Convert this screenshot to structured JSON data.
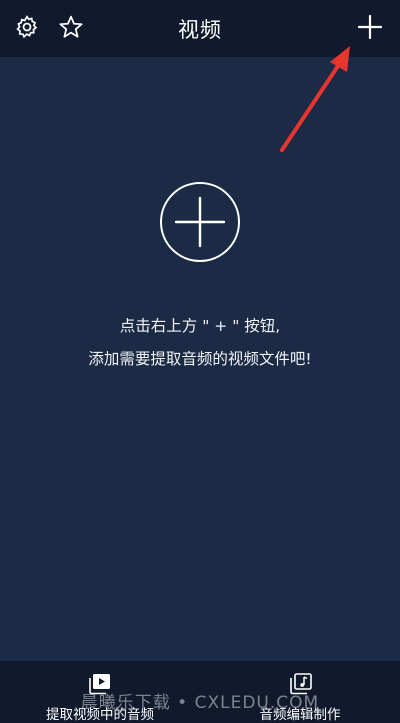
{
  "header": {
    "title": "视频",
    "icons": {
      "settings": "gear-icon",
      "favorite": "star-icon",
      "add": "plus-icon"
    }
  },
  "main": {
    "add_icon": "circle-plus-icon",
    "hint_line1": "点击右上方 \" + \" 按钮,",
    "hint_line2": "添加需要提取音频的视频文件吧!"
  },
  "bottom_nav": {
    "tabs": [
      {
        "label": "提取视频中的音频",
        "icon": "video-play-icon"
      },
      {
        "label": "音频编辑制作",
        "icon": "music-note-icon"
      }
    ]
  },
  "watermark": "晨曦乐下载 • CXLEDU.COM",
  "colors": {
    "background": "#1b2a45",
    "bars": "#111a2d",
    "annotation_arrow": "#e8362f"
  }
}
